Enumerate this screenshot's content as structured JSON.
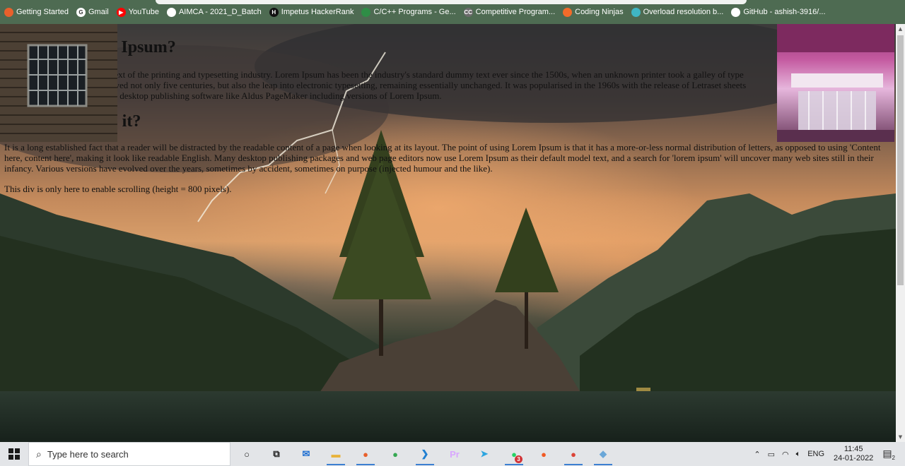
{
  "bookmarks": [
    {
      "label": "Getting Started",
      "icon": "firefox-icon",
      "color": "#e8602c",
      "glyph": ""
    },
    {
      "label": "Gmail",
      "icon": "google-icon",
      "color": "#ffffff",
      "glyph": "G"
    },
    {
      "label": "YouTube",
      "icon": "youtube-icon",
      "color": "#ff0000",
      "glyph": "▶"
    },
    {
      "label": "AIMCA - 2021_D_Batch",
      "icon": "group-icon",
      "color": "#ffffff",
      "glyph": ""
    },
    {
      "label": "Impetus HackerRank",
      "icon": "hackerrank-icon",
      "color": "#111111",
      "glyph": "H"
    },
    {
      "label": "C/C++ Programs - Ge...",
      "icon": "gfg-icon",
      "color": "#2f8d46",
      "glyph": ""
    },
    {
      "label": "Competitive Program...",
      "icon": "codechef-icon",
      "color": "#6b6b6b",
      "glyph": "CC"
    },
    {
      "label": "Coding Ninjas",
      "icon": "codingninjas-icon",
      "color": "#f26b2a",
      "glyph": ""
    },
    {
      "label": "Overload resolution b...",
      "icon": "cppreference-icon",
      "color": "#3fb6c4",
      "glyph": ""
    },
    {
      "label": "GitHub - ashish-3916/...",
      "icon": "github-icon",
      "color": "#ffffff",
      "glyph": ""
    }
  ],
  "page": {
    "heading1_visible": "n Ipsum?",
    "para1_line1": "y text of the printing and typesetting industry. Lorem Ipsum has been the industry's standard dummy text ever since the 1500s, when an unknown printer took a galley of type",
    "para1_line2": "rvived not only five centuries, but also the leap into electronic typesetting, remaining essentially unchanged. It was popularised in the 1960s with the release of Letraset sheets",
    "para1_line3": "rith desktop publishing software like Aldus PageMaker including versions of Lorem Ipsum.",
    "heading2_visible": "e it?",
    "para2": "It is a long established fact that a reader will be distracted by the readable content of a page when looking at its layout. The point of using Lorem Ipsum is that it has a more-or-less normal distribution of letters, as opposed to using 'Content here, content here', making it look like readable English. Many desktop publishing packages and web page editors now use Lorem Ipsum as their default model text, and a search for 'lorem ipsum' will uncover many web sites still in their infancy. Various versions have evolved over the years, sometimes by accident, sometimes on purpose (injected humour and the like).",
    "para3": "This div is only here to enable scrolling (height = 800 pixels)."
  },
  "taskbar": {
    "search_placeholder": "Type here to search",
    "apps": [
      {
        "name": "cortana-icon",
        "glyph": "○",
        "color": "#222222"
      },
      {
        "name": "task-view-icon",
        "glyph": "⧉",
        "color": "#222222"
      },
      {
        "name": "mail-icon",
        "glyph": "✉",
        "color": "#1f6fd1"
      },
      {
        "name": "file-explorer-icon",
        "glyph": "▬",
        "color": "#e8b33c"
      },
      {
        "name": "firefox-icon",
        "glyph": "●",
        "color": "#e8602c"
      },
      {
        "name": "maps-icon",
        "glyph": "●",
        "color": "#36a852"
      },
      {
        "name": "vscode-icon",
        "glyph": "❯",
        "color": "#1f7fd1"
      },
      {
        "name": "premiere-icon",
        "glyph": "Pr",
        "color": "#d9a6ff"
      },
      {
        "name": "telegram-icon",
        "glyph": "➤",
        "color": "#2ca5e0"
      },
      {
        "name": "whatsapp-icon",
        "glyph": "●",
        "color": "#25d366",
        "badge": "3"
      },
      {
        "name": "brave-icon",
        "glyph": "●",
        "color": "#f15a24"
      },
      {
        "name": "chrome-icon",
        "glyph": "●",
        "color": "#db4437"
      },
      {
        "name": "app-icon",
        "glyph": "◆",
        "color": "#6aa7d8"
      }
    ],
    "tray": {
      "language": "ENG",
      "time": "11:45",
      "date": "24-01-2022",
      "notification_count": "2"
    }
  }
}
